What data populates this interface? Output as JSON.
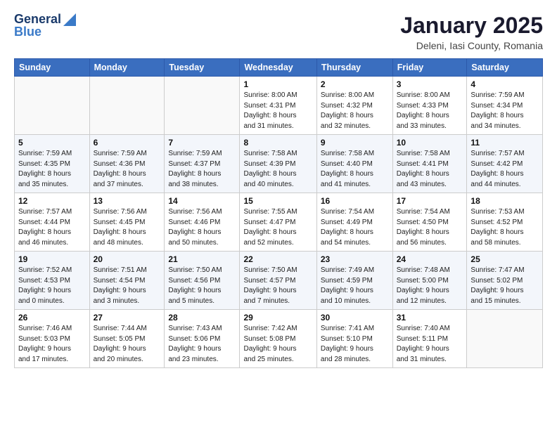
{
  "header": {
    "logo_line1": "General",
    "logo_line2": "Blue",
    "title": "January 2025",
    "subtitle": "Deleni, Iasi County, Romania"
  },
  "weekdays": [
    "Sunday",
    "Monday",
    "Tuesday",
    "Wednesday",
    "Thursday",
    "Friday",
    "Saturday"
  ],
  "weeks": [
    [
      {
        "num": "",
        "info": ""
      },
      {
        "num": "",
        "info": ""
      },
      {
        "num": "",
        "info": ""
      },
      {
        "num": "1",
        "info": "Sunrise: 8:00 AM\nSunset: 4:31 PM\nDaylight: 8 hours\nand 31 minutes."
      },
      {
        "num": "2",
        "info": "Sunrise: 8:00 AM\nSunset: 4:32 PM\nDaylight: 8 hours\nand 32 minutes."
      },
      {
        "num": "3",
        "info": "Sunrise: 8:00 AM\nSunset: 4:33 PM\nDaylight: 8 hours\nand 33 minutes."
      },
      {
        "num": "4",
        "info": "Sunrise: 7:59 AM\nSunset: 4:34 PM\nDaylight: 8 hours\nand 34 minutes."
      }
    ],
    [
      {
        "num": "5",
        "info": "Sunrise: 7:59 AM\nSunset: 4:35 PM\nDaylight: 8 hours\nand 35 minutes."
      },
      {
        "num": "6",
        "info": "Sunrise: 7:59 AM\nSunset: 4:36 PM\nDaylight: 8 hours\nand 37 minutes."
      },
      {
        "num": "7",
        "info": "Sunrise: 7:59 AM\nSunset: 4:37 PM\nDaylight: 8 hours\nand 38 minutes."
      },
      {
        "num": "8",
        "info": "Sunrise: 7:58 AM\nSunset: 4:39 PM\nDaylight: 8 hours\nand 40 minutes."
      },
      {
        "num": "9",
        "info": "Sunrise: 7:58 AM\nSunset: 4:40 PM\nDaylight: 8 hours\nand 41 minutes."
      },
      {
        "num": "10",
        "info": "Sunrise: 7:58 AM\nSunset: 4:41 PM\nDaylight: 8 hours\nand 43 minutes."
      },
      {
        "num": "11",
        "info": "Sunrise: 7:57 AM\nSunset: 4:42 PM\nDaylight: 8 hours\nand 44 minutes."
      }
    ],
    [
      {
        "num": "12",
        "info": "Sunrise: 7:57 AM\nSunset: 4:44 PM\nDaylight: 8 hours\nand 46 minutes."
      },
      {
        "num": "13",
        "info": "Sunrise: 7:56 AM\nSunset: 4:45 PM\nDaylight: 8 hours\nand 48 minutes."
      },
      {
        "num": "14",
        "info": "Sunrise: 7:56 AM\nSunset: 4:46 PM\nDaylight: 8 hours\nand 50 minutes."
      },
      {
        "num": "15",
        "info": "Sunrise: 7:55 AM\nSunset: 4:47 PM\nDaylight: 8 hours\nand 52 minutes."
      },
      {
        "num": "16",
        "info": "Sunrise: 7:54 AM\nSunset: 4:49 PM\nDaylight: 8 hours\nand 54 minutes."
      },
      {
        "num": "17",
        "info": "Sunrise: 7:54 AM\nSunset: 4:50 PM\nDaylight: 8 hours\nand 56 minutes."
      },
      {
        "num": "18",
        "info": "Sunrise: 7:53 AM\nSunset: 4:52 PM\nDaylight: 8 hours\nand 58 minutes."
      }
    ],
    [
      {
        "num": "19",
        "info": "Sunrise: 7:52 AM\nSunset: 4:53 PM\nDaylight: 9 hours\nand 0 minutes."
      },
      {
        "num": "20",
        "info": "Sunrise: 7:51 AM\nSunset: 4:54 PM\nDaylight: 9 hours\nand 3 minutes."
      },
      {
        "num": "21",
        "info": "Sunrise: 7:50 AM\nSunset: 4:56 PM\nDaylight: 9 hours\nand 5 minutes."
      },
      {
        "num": "22",
        "info": "Sunrise: 7:50 AM\nSunset: 4:57 PM\nDaylight: 9 hours\nand 7 minutes."
      },
      {
        "num": "23",
        "info": "Sunrise: 7:49 AM\nSunset: 4:59 PM\nDaylight: 9 hours\nand 10 minutes."
      },
      {
        "num": "24",
        "info": "Sunrise: 7:48 AM\nSunset: 5:00 PM\nDaylight: 9 hours\nand 12 minutes."
      },
      {
        "num": "25",
        "info": "Sunrise: 7:47 AM\nSunset: 5:02 PM\nDaylight: 9 hours\nand 15 minutes."
      }
    ],
    [
      {
        "num": "26",
        "info": "Sunrise: 7:46 AM\nSunset: 5:03 PM\nDaylight: 9 hours\nand 17 minutes."
      },
      {
        "num": "27",
        "info": "Sunrise: 7:44 AM\nSunset: 5:05 PM\nDaylight: 9 hours\nand 20 minutes."
      },
      {
        "num": "28",
        "info": "Sunrise: 7:43 AM\nSunset: 5:06 PM\nDaylight: 9 hours\nand 23 minutes."
      },
      {
        "num": "29",
        "info": "Sunrise: 7:42 AM\nSunset: 5:08 PM\nDaylight: 9 hours\nand 25 minutes."
      },
      {
        "num": "30",
        "info": "Sunrise: 7:41 AM\nSunset: 5:10 PM\nDaylight: 9 hours\nand 28 minutes."
      },
      {
        "num": "31",
        "info": "Sunrise: 7:40 AM\nSunset: 5:11 PM\nDaylight: 9 hours\nand 31 minutes."
      },
      {
        "num": "",
        "info": ""
      }
    ]
  ]
}
